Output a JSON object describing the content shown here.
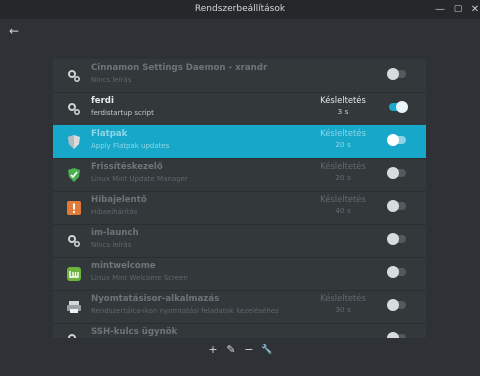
{
  "window": {
    "title": "Rendszerbeállítások",
    "controls": {
      "minimize": "—",
      "maximize": "▢",
      "close": "✕"
    }
  },
  "nav": {
    "back_icon": "←"
  },
  "startup_items": [
    {
      "name": "Cinnamon Settings Daemon - xrandr",
      "description": "Nincs leírás",
      "delay_label": "",
      "delay_value": "",
      "enabled": false,
      "dimmed": true,
      "selected": false,
      "icon": "gears-icon"
    },
    {
      "name": "ferdi",
      "description": "ferdistartup script",
      "delay_label": "Késleltetés",
      "delay_value": "3 s",
      "enabled": true,
      "dimmed": false,
      "selected": false,
      "icon": "gears-icon"
    },
    {
      "name": "Flatpak",
      "description": "Apply Flatpak updates",
      "delay_label": "Késleltetés",
      "delay_value": "20 s",
      "enabled": false,
      "dimmed": true,
      "selected": true,
      "icon": "shield-icon"
    },
    {
      "name": "Frissítéskezelő",
      "description": "Linux Mint Update Manager",
      "delay_label": "Késleltetés",
      "delay_value": "20 s",
      "enabled": false,
      "dimmed": true,
      "selected": false,
      "icon": "update-shield-icon"
    },
    {
      "name": "Hibajelentő",
      "description": "Hibaelhárítás",
      "delay_label": "Késleltetés",
      "delay_value": "40 s",
      "enabled": false,
      "dimmed": true,
      "selected": false,
      "icon": "warning-icon"
    },
    {
      "name": "im-launch",
      "description": "Nincs leírás",
      "delay_label": "",
      "delay_value": "",
      "enabled": false,
      "dimmed": true,
      "selected": false,
      "icon": "gears-icon"
    },
    {
      "name": "mintwelcome",
      "description": "Linux Mint Welcome Screen",
      "delay_label": "",
      "delay_value": "",
      "enabled": false,
      "dimmed": true,
      "selected": false,
      "icon": "mint-logo-icon"
    },
    {
      "name": "Nyomtatásisor-alkalmazás",
      "description": "Rendszertálca-ikon nyomtatási feladatok kezeléséhez",
      "delay_label": "Késleltetés",
      "delay_value": "30 s",
      "enabled": false,
      "dimmed": true,
      "selected": false,
      "icon": "printer-icon"
    },
    {
      "name": "SSH-kulcs ügynök",
      "description": "",
      "delay_label": "",
      "delay_value": "",
      "enabled": false,
      "dimmed": true,
      "selected": false,
      "icon": "gears-icon"
    }
  ],
  "toolbar": {
    "add_icon": "+",
    "edit_icon": "✎",
    "remove_icon": "−",
    "run_icon": "🔧"
  }
}
